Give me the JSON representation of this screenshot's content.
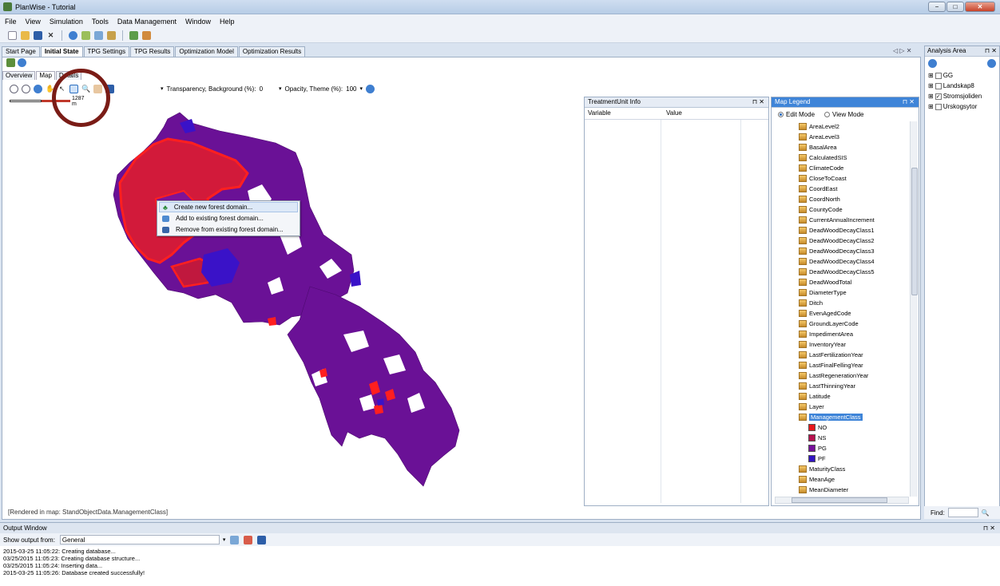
{
  "window": {
    "title": "PlanWise - Tutorial",
    "controls": [
      "−",
      "□",
      "✕"
    ]
  },
  "menu": [
    "File",
    "View",
    "Simulation",
    "Tools",
    "Data Management",
    "Window",
    "Help"
  ],
  "doc_tabs": [
    {
      "label": "Start Page",
      "active": false
    },
    {
      "label": "Initial State",
      "active": true
    },
    {
      "label": "TPG Settings",
      "active": false
    },
    {
      "label": "TPG Results",
      "active": false
    },
    {
      "label": "Optimization Model",
      "active": false
    },
    {
      "label": "Optimization Results",
      "active": false
    }
  ],
  "tab_controls": "◁ ▷ ✕",
  "sub_tabs": [
    {
      "label": "Overview",
      "active": false
    },
    {
      "label": "Map",
      "active": true
    },
    {
      "label": "Details",
      "active": false
    }
  ],
  "map_toolbar": {
    "transparency_label": "Transparency, Background (%):",
    "transparency_value": "0",
    "opacity_label": "Opacity, Theme (%):",
    "opacity_value": "100"
  },
  "scalebar": {
    "label": "1287 m"
  },
  "context_menu": [
    {
      "label": "Create new forest domain...",
      "icon": "tree-icon",
      "highlighted": true
    },
    {
      "label": "Add to existing forest domain...",
      "icon": "add-domain-icon",
      "highlighted": false
    },
    {
      "label": "Remove from existing forest domain...",
      "icon": "remove-domain-icon",
      "highlighted": false
    }
  ],
  "rendered_status": "[Rendered in map: StandObjectData.ManagementClass]",
  "treatment_panel": {
    "title": "TreatmentUnit Info",
    "columns": [
      "Variable",
      "Value"
    ]
  },
  "legend_panel": {
    "title": "Map Legend",
    "modes": [
      {
        "label": "Edit Mode",
        "selected": true
      },
      {
        "label": "View Mode",
        "selected": false
      }
    ],
    "items": [
      "AreaLevel2",
      "AreaLevel3",
      "BasalArea",
      "CalculatedSIS",
      "ClimateCode",
      "CloseToCoast",
      "CoordEast",
      "CoordNorth",
      "CountyCode",
      "CurrentAnnualIncrement",
      "DeadWoodDecayClass1",
      "DeadWoodDecayClass2",
      "DeadWoodDecayClass3",
      "DeadWoodDecayClass4",
      "DeadWoodDecayClass5",
      "DeadWoodTotal",
      "DiameterType",
      "Ditch",
      "EvenAgedCode",
      "GroundLayerCode",
      "ImpedimentArea",
      "InventoryYear",
      "LastFertilizationYear",
      "LastFinalFellingYear",
      "LastRegenerationYear",
      "LastThinningYear",
      "Latitude",
      "Layer"
    ],
    "selected_item": "ManagementClass",
    "classes": [
      {
        "label": "NO",
        "color": "#e8171b"
      },
      {
        "label": "NS",
        "color": "#b5124e"
      },
      {
        "label": "PG",
        "color": "#76119a"
      },
      {
        "label": "PF",
        "color": "#3215c2"
      }
    ],
    "after_items": [
      "MaturityClass",
      "MeanAge",
      "MeanDiameter"
    ]
  },
  "analysis_area": {
    "title": "Analysis Area",
    "items": [
      {
        "label": "GG",
        "checked": false
      },
      {
        "label": "Landskap8",
        "checked": false
      },
      {
        "label": "Stromsjoliden",
        "checked": true
      },
      {
        "label": "Urskogsytor",
        "checked": false
      }
    ],
    "find_label": "Find:"
  },
  "output": {
    "title": "Output Window",
    "show_label": "Show output from:",
    "source": "General",
    "lines": [
      "2015-03-25 11:05:22: Creating database...",
      "03/25/2015 11:05:23: Creating database structure...",
      "03/25/2015 11:05:24: Inserting data...",
      "2015-03-25 11:05:26: Database created successfully!"
    ]
  },
  "colors": {
    "map_main": "#6a1196",
    "map_red": "#ff1f1f",
    "map_blue": "#3a12c8",
    "zoom_circle": "#7a1c16"
  }
}
